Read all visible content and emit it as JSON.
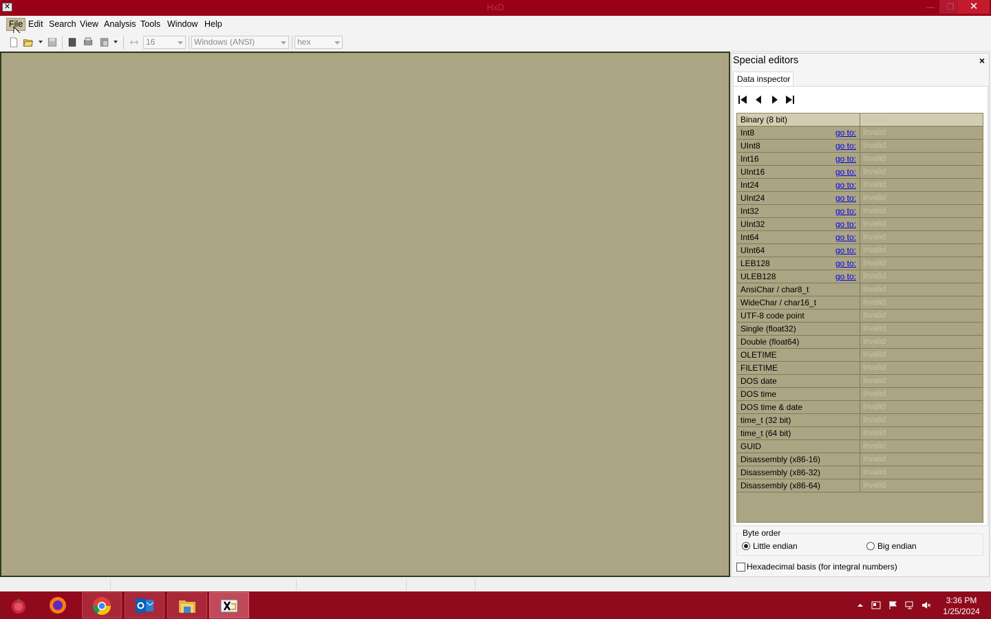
{
  "window": {
    "title": "HxD",
    "app_icon_glyph": "✕",
    "minimize_glyph": "—",
    "maximize_glyph": "❐",
    "close_glyph": "✕"
  },
  "menu": [
    "File",
    "Edit",
    "Search",
    "View",
    "Analysis",
    "Tools",
    "Window",
    "Help"
  ],
  "toolbar": {
    "bytes_per_row": "16",
    "charset": "Windows (ANSI)",
    "offset_base": "hex"
  },
  "special_editors": {
    "title": "Special editors",
    "close_glyph": "×",
    "tab_label": "Data inspector",
    "goto_label": "go to:",
    "rows": [
      {
        "name": "Binary (8 bit)",
        "goto": false,
        "value": "Invalid"
      },
      {
        "name": "Int8",
        "goto": true,
        "value": "Invalid"
      },
      {
        "name": "UInt8",
        "goto": true,
        "value": "Invalid"
      },
      {
        "name": "Int16",
        "goto": true,
        "value": "Invalid"
      },
      {
        "name": "UInt16",
        "goto": true,
        "value": "Invalid"
      },
      {
        "name": "Int24",
        "goto": true,
        "value": "Invalid"
      },
      {
        "name": "UInt24",
        "goto": true,
        "value": "Invalid"
      },
      {
        "name": "Int32",
        "goto": true,
        "value": "Invalid"
      },
      {
        "name": "UInt32",
        "goto": true,
        "value": "Invalid"
      },
      {
        "name": "Int64",
        "goto": true,
        "value": "Invalid"
      },
      {
        "name": "UInt64",
        "goto": true,
        "value": "Invalid"
      },
      {
        "name": "LEB128",
        "goto": true,
        "value": "Invalid"
      },
      {
        "name": "ULEB128",
        "goto": true,
        "value": "Invalid"
      },
      {
        "name": "AnsiChar / char8_t",
        "goto": false,
        "value": "Invalid"
      },
      {
        "name": "WideChar / char16_t",
        "goto": false,
        "value": "Invalid"
      },
      {
        "name": "UTF-8 code point",
        "goto": false,
        "value": "Invalid"
      },
      {
        "name": "Single (float32)",
        "goto": false,
        "value": "Invalid"
      },
      {
        "name": "Double (float64)",
        "goto": false,
        "value": "Invalid"
      },
      {
        "name": "OLETIME",
        "goto": false,
        "value": "Invalid"
      },
      {
        "name": "FILETIME",
        "goto": false,
        "value": "Invalid"
      },
      {
        "name": "DOS date",
        "goto": false,
        "value": "Invalid"
      },
      {
        "name": "DOS time",
        "goto": false,
        "value": "Invalid"
      },
      {
        "name": "DOS time & date",
        "goto": false,
        "value": "Invalid"
      },
      {
        "name": "time_t (32 bit)",
        "goto": false,
        "value": "Invalid"
      },
      {
        "name": "time_t (64 bit)",
        "goto": false,
        "value": "Invalid"
      },
      {
        "name": "GUID",
        "goto": false,
        "value": "Invalid"
      },
      {
        "name": "Disassembly (x86-16)",
        "goto": false,
        "value": "Invalid"
      },
      {
        "name": "Disassembly (x86-32)",
        "goto": false,
        "value": "Invalid"
      },
      {
        "name": "Disassembly (x86-64)",
        "goto": false,
        "value": "Invalid"
      }
    ],
    "byte_order": {
      "legend": "Byte order",
      "little_endian": "Little endian",
      "big_endian": "Big endian",
      "selected": "little_endian"
    },
    "hex_basis_label": "Hexadecimal basis (for integral numbers)",
    "hex_basis_checked": false
  },
  "taskbar": {
    "apps": [
      "start-icon",
      "firefox-icon",
      "chrome-icon",
      "outlook-icon",
      "file-explorer-icon",
      "hxd-icon"
    ],
    "time": "3:36 PM",
    "date": "1/25/2024"
  },
  "colors": {
    "title_bar": "#9a0018",
    "editor_bg": "#aba583",
    "taskbar": "#8f0a1c",
    "link": "#0000ee"
  }
}
